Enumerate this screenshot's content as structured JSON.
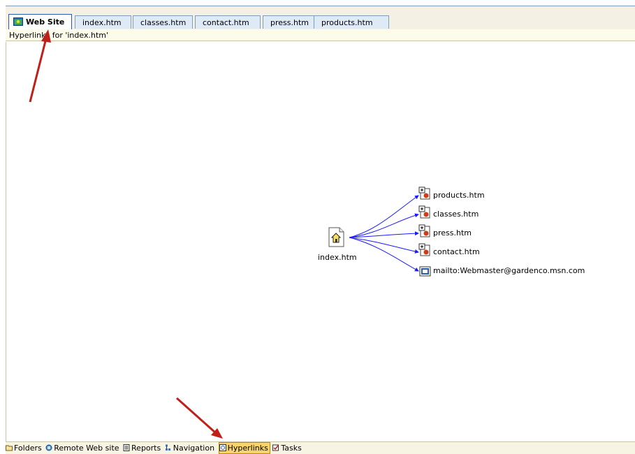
{
  "tabs": {
    "active": "Web Site",
    "items": [
      "index.htm",
      "classes.htm",
      "contact.htm",
      "press.htm",
      "products.htm"
    ]
  },
  "subheader": {
    "text": "Hyperlinks for 'index.htm'"
  },
  "diagram": {
    "center": "index.htm",
    "links": [
      {
        "label": "products.htm",
        "icon": "page-expand-icon"
      },
      {
        "label": "classes.htm",
        "icon": "page-expand-icon"
      },
      {
        "label": "press.htm",
        "icon": "page-expand-icon"
      },
      {
        "label": "contact.htm",
        "icon": "page-expand-icon"
      },
      {
        "label": "mailto:Webmaster@gardenco.msn.com",
        "icon": "mail-link-icon"
      }
    ],
    "line_color": "#1a1aff"
  },
  "views": {
    "items": [
      {
        "label": "Folders",
        "icon": "folder-icon"
      },
      {
        "label": "Remote Web site",
        "icon": "remote-site-icon"
      },
      {
        "label": "Reports",
        "icon": "reports-icon"
      },
      {
        "label": "Navigation",
        "icon": "navigation-icon"
      },
      {
        "label": "Hyperlinks",
        "icon": "hyperlinks-icon",
        "active": true
      },
      {
        "label": "Tasks",
        "icon": "tasks-icon"
      }
    ]
  },
  "annotations": {
    "arrow_color": "#c0201a"
  }
}
